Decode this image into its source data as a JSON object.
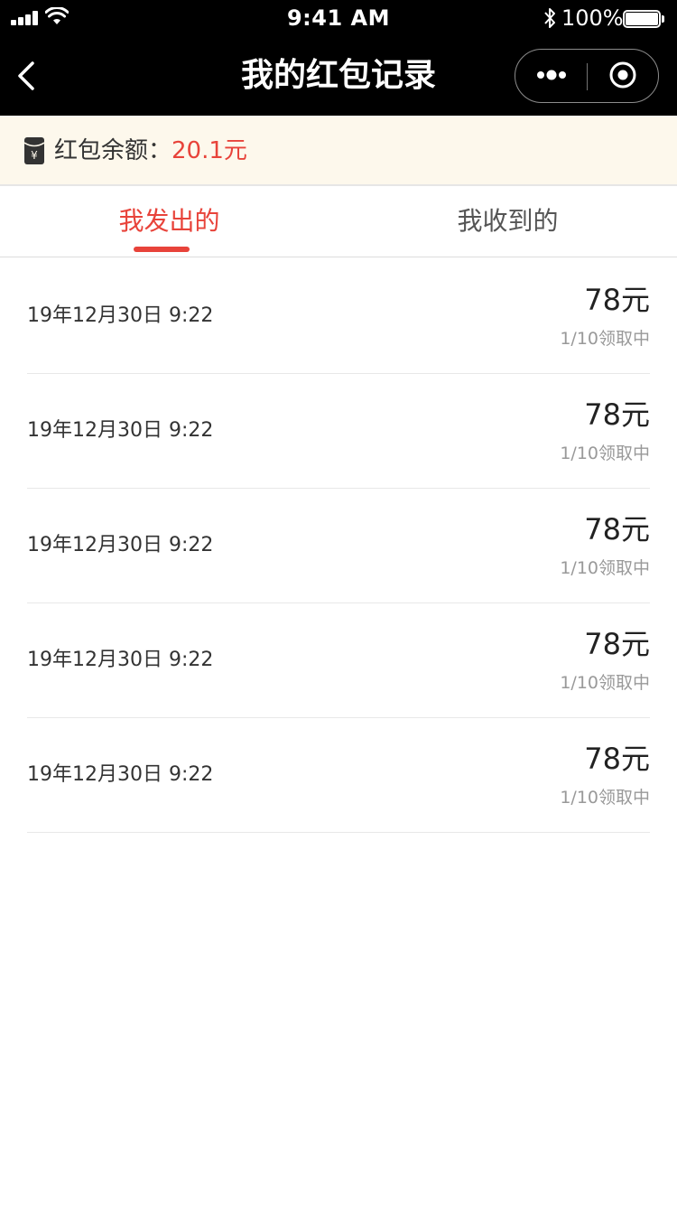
{
  "status_bar": {
    "time": "9:41 AM",
    "battery": "100%",
    "battery_level": 1.0,
    "icons": [
      "signal-icon",
      "wifi-icon",
      "bluetooth-icon",
      "battery-icon"
    ]
  },
  "nav": {
    "title": "我的红包记录",
    "icons": [
      "back-arrow-icon",
      "more-dots-icon",
      "target-close-icon"
    ]
  },
  "balance": {
    "label": "红包余额：",
    "value": "20.1元",
    "icon": "red-packet-icon",
    "value_color": "#e8433a"
  },
  "tabs": [
    {
      "label": "我发出的",
      "active": true
    },
    {
      "label": "我收到的",
      "active": false
    }
  ],
  "records": [
    {
      "date": "19年12月30日 9:22",
      "amount": "78元",
      "status": "1/10领取中"
    },
    {
      "date": "19年12月30日 9:22",
      "amount": "78元",
      "status": "1/10领取中"
    },
    {
      "date": "19年12月30日 9:22",
      "amount": "78元",
      "status": "1/10领取中"
    },
    {
      "date": "19年12月30日 9:22",
      "amount": "78元",
      "status": "1/10领取中"
    },
    {
      "date": "19年12月30日 9:22",
      "amount": "78元",
      "status": "1/10领取中"
    }
  ],
  "colors": {
    "accent": "#e8433a",
    "header_bg": "#000000",
    "balance_bg": "#fdf8ec"
  }
}
